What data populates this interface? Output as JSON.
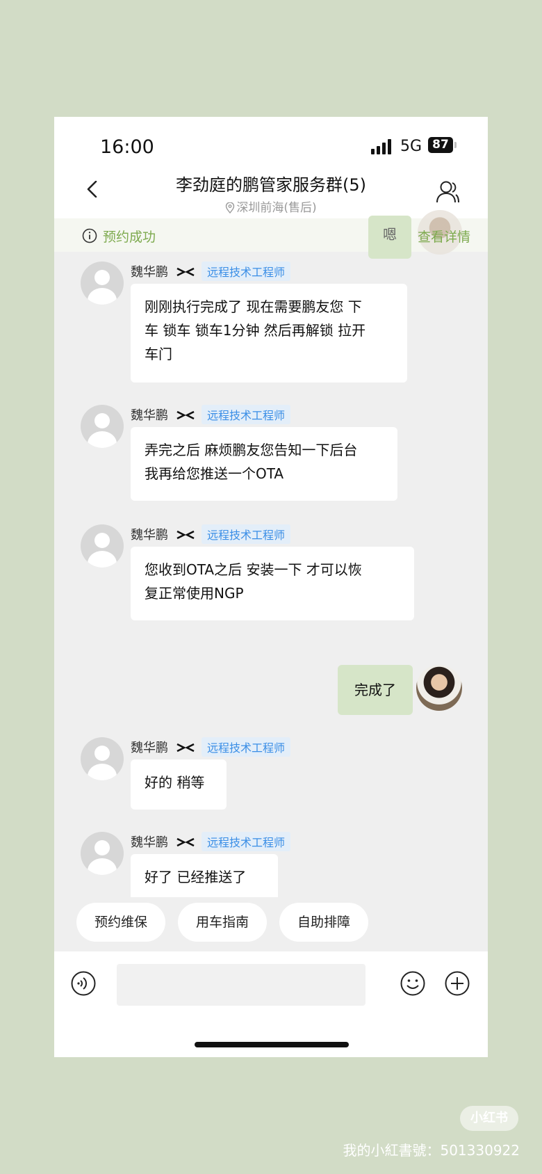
{
  "status": {
    "time": "16:00",
    "network": "5G",
    "battery": "87"
  },
  "header": {
    "title": "李劲庭的鹏管家服务群(5)",
    "location": "深圳前海(售后)"
  },
  "notice": {
    "text": "预约成功",
    "bubble_text": "嗯",
    "link": "查看详情"
  },
  "messages": [
    {
      "sender": "魏华鹏",
      "role": "远程技术工程师",
      "lines": [
        "刚刚执行完成了  现在需要鹏友您 下",
        "车 锁车 锁车1分钟 然后再解锁 拉开",
        "车门"
      ]
    },
    {
      "sender": "魏华鹏",
      "role": "远程技术工程师",
      "lines": [
        "弄完之后 麻烦鹏友您告知一下后台",
        "我再给您推送一个OTA"
      ]
    },
    {
      "sender": "魏华鹏",
      "role": "远程技术工程师",
      "lines": [
        "您收到OTA之后  安装一下  才可以恢",
        "复正常使用NGP"
      ]
    },
    {
      "self": true,
      "text": "完成了"
    },
    {
      "sender": "魏华鹏",
      "role": "远程技术工程师",
      "lines": [
        "好的 稍等"
      ]
    },
    {
      "sender": "魏华鹏",
      "role": "远程技术工程师",
      "lines": [
        "好了  已经推送了"
      ]
    }
  ],
  "quick_actions": [
    "预约维保",
    "用车指南",
    "自助排障"
  ],
  "watermark": {
    "brand": "小红书",
    "id": "我的小紅書號：501330922"
  },
  "colors": {
    "page_bg": "#d2dcc6",
    "accent_green": "#7daa4e",
    "self_bubble": "#d6e5c8",
    "role_tag": "#3a8ee6"
  }
}
